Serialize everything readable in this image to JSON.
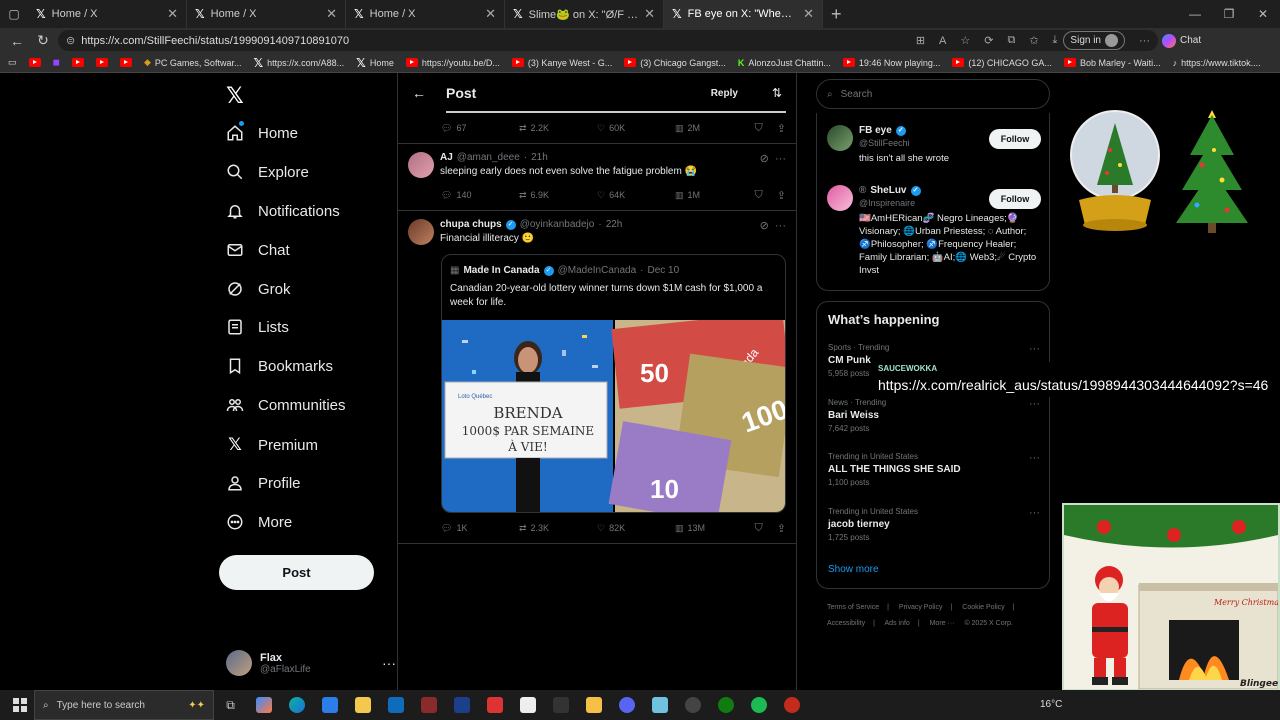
{
  "browser": {
    "tabs": [
      {
        "title": "Home / X",
        "active": false
      },
      {
        "title": "Home / X",
        "active": false
      },
      {
        "title": "Home / X",
        "active": false
      },
      {
        "title": "Slime🐸 on X: \"Ø/F girl gets mad at",
        "active": false
      },
      {
        "title": "FB eye on X: \"When I saw his son I",
        "active": true
      }
    ],
    "url": "https://x.com/StillFeechi/status/1999091409710891070",
    "signin_label": "Sign in",
    "chat_label": "Chat",
    "bookmarks": [
      "",
      "",
      "",
      "",
      "PC Games, Softwar...",
      "https://x.com/A88...",
      "Home",
      "https://youtu.be/D...",
      "(3) Kanye West - G...",
      "(3) Chicago Gangst...",
      "AlonzoJust Chattin...",
      "19:46 Now playing...",
      "(12) CHICAGO GA...",
      "Bob Marley - Waiti...",
      "https://www.tiktok...."
    ]
  },
  "nav": {
    "items": [
      "Home",
      "Explore",
      "Notifications",
      "Chat",
      "Grok",
      "Lists",
      "Bookmarks",
      "Communities",
      "Premium",
      "Profile",
      "More"
    ],
    "post_label": "Post",
    "account": {
      "name": "Flax",
      "handle": "@aFlaxLife"
    }
  },
  "header": {
    "title": "Post",
    "reply_label": "Reply"
  },
  "top_actions": {
    "replies": "67",
    "reposts": "2.2K",
    "likes": "60K",
    "views": "2M"
  },
  "tweets": [
    {
      "name": "AJ",
      "handle": "@aman_deee",
      "time": "21h",
      "text": "sleeping early does not even solve the fatigue problem 😭",
      "replies": "140",
      "reposts": "6.9K",
      "likes": "64K",
      "views": "1M"
    },
    {
      "name": "chupa chups",
      "handle": "@oyinkanbadejo",
      "time": "22h",
      "text": "Financial illiteracy 🙂",
      "replies": "1K",
      "reposts": "2.3K",
      "likes": "82K",
      "views": "13M"
    }
  ],
  "quote": {
    "name": "Made In Canada",
    "handle": "@MadeInCanada",
    "date": "Dec 10",
    "text": "Canadian 20-year-old lottery winner turns down $1M cash for $1,000 a week for life.",
    "sign_line1": "BRENDA",
    "sign_line2": "1000$ PAR SEMAINE",
    "sign_line3": "À VIE!",
    "sign_logo": "Loto Québec",
    "bill_50": "50",
    "bill_100": "100",
    "bill_10": "10",
    "bill_word": "Canada"
  },
  "search": {
    "placeholder": "Search"
  },
  "who_to_follow": [
    {
      "name": "FB eye",
      "handle": "@StillFeechi",
      "bio": "this isn't all she wrote",
      "follow_label": "Follow"
    },
    {
      "name": "SheLuv",
      "handle": "@Inspirenaire",
      "bio": "🇺🇸AmHERican🧬 Negro Lineages;🔮Visionary; 🌐Urban Priestess; ◌ Author; ♐Philosopher; ♐Frequency Healer;   Family Librarian; 🤖AI;🌐 Web3;☄ Crypto Invst",
      "follow_label": "Follow"
    }
  ],
  "happening": {
    "title": "What’s happening",
    "trends": [
      {
        "category": "Sports · Trending",
        "title": "CM Punk",
        "count": "5,958 posts"
      },
      {
        "category": "News · Trending",
        "title": "Bari Weiss",
        "count": "7,642 posts"
      },
      {
        "category": "Trending in United States",
        "title": "ALL THE THINGS SHE SAID",
        "count": "1,100 posts"
      },
      {
        "category": "Trending in United States",
        "title": "jacob tierney",
        "count": "1,725 posts"
      }
    ],
    "show_more": "Show more"
  },
  "footer": [
    "Terms of Service",
    "Privacy Policy",
    "Cookie Policy",
    "Accessibility",
    "Ads info",
    "More ···",
    "© 2025 X Corp."
  ],
  "tooltip": {
    "label": "SAUCEWOKKA",
    "link": "https://x.com/realrick_aus/status/1998944303444644092?s=46"
  },
  "xmas": {
    "greeting": "Merry Christmas",
    "brand": "Blingee"
  },
  "taskbar": {
    "search_placeholder": "Type here to search",
    "temperature": "16°C"
  },
  "colors": {
    "accent": "#1d9bf0",
    "background": "#000000",
    "border": "#2f3336",
    "muted": "#71767b"
  }
}
